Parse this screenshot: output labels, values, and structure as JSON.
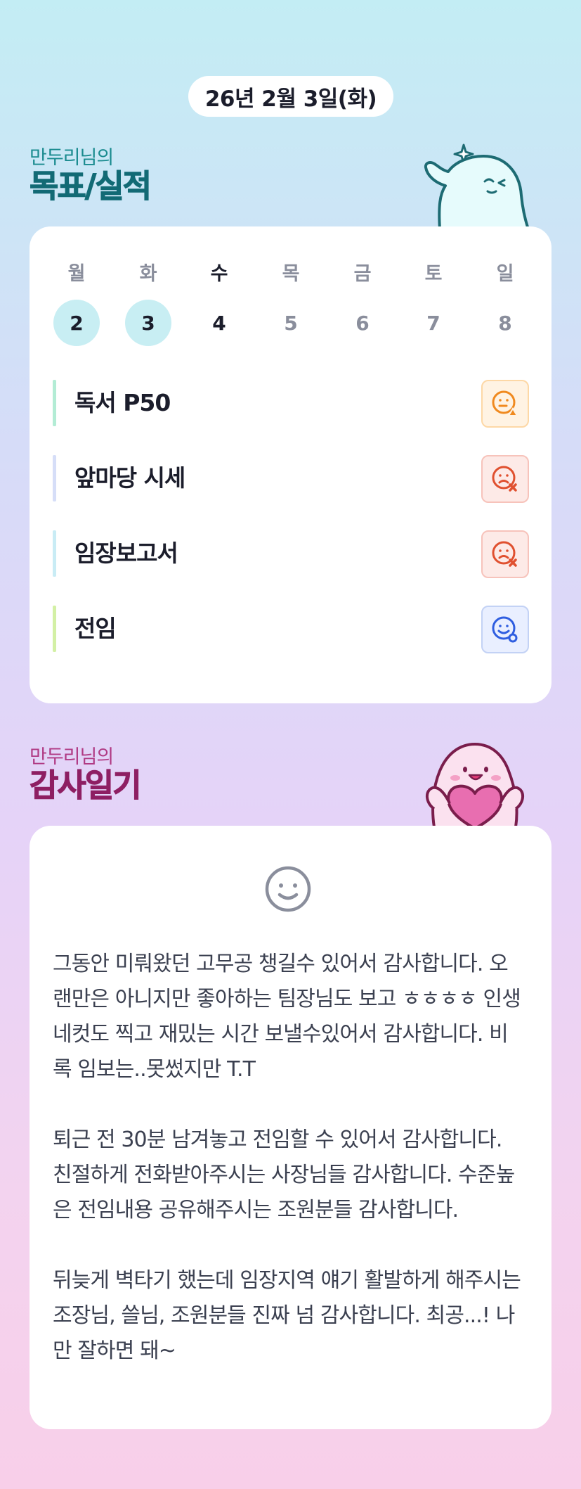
{
  "header": {
    "date": "26년 2월 3일(화)"
  },
  "goals_section": {
    "subtitle": "만두리님의",
    "title": "목표/실적",
    "week": [
      {
        "dow": "월",
        "num": "2",
        "state": "past"
      },
      {
        "dow": "화",
        "num": "3",
        "state": "past"
      },
      {
        "dow": "수",
        "num": "4",
        "state": "current"
      },
      {
        "dow": "목",
        "num": "5",
        "state": "future"
      },
      {
        "dow": "금",
        "num": "6",
        "state": "future"
      },
      {
        "dow": "토",
        "num": "7",
        "state": "future"
      },
      {
        "dow": "일",
        "num": "8",
        "state": "future"
      }
    ],
    "goals": [
      {
        "label": "독서 P50",
        "bar_color": "#b3ecd5",
        "status": "partial",
        "status_icon": "smile-triangle-icon",
        "status_color": "#f08a1f"
      },
      {
        "label": "앞마당 시세",
        "bar_color": "#d6def8",
        "status": "fail",
        "status_icon": "smile-x-icon",
        "status_color": "#e0502f"
      },
      {
        "label": "임장보고서",
        "bar_color": "#c9ecf5",
        "status": "fail",
        "status_icon": "smile-x-icon",
        "status_color": "#e0502f"
      },
      {
        "label": "전임",
        "bar_color": "#d3f0a5",
        "status": "done",
        "status_icon": "smile-circle-icon",
        "status_color": "#2f5ee0"
      }
    ]
  },
  "gratitude_section": {
    "subtitle": "만두리님의",
    "title": "감사일기",
    "mood_icon": "smile-face-icon",
    "paragraphs": [
      "그동안 미뤄왔던 고무공 챙길수 있어서 감사합니다. 오랜만은 아니지만 좋아하는 팀장님도 보고 ㅎㅎㅎㅎ 인생네컷도 찍고 재밌는 시간 보낼수있어서 감사합니다. 비록 임보는..못썼지만 T.T",
      "퇴근 전 30분 남겨놓고 전임할 수 있어서 감사합니다. 친절하게 전화받아주시는 사장님들 감사합니다. 수준높은 전임내용 공유해주시는 조원분들 감사합니다.",
      "뒤늦게 벽타기 했는데 임장지역 얘기 활발하게 해주시는 조장님, 쓸님, 조원분들 진짜 넘 감사합니다. 최공...! 나만 잘하면 돼~"
    ]
  }
}
